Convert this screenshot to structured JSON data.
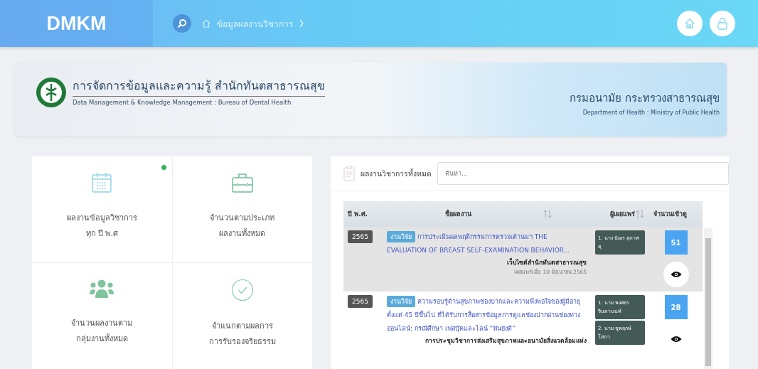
{
  "topbar": {
    "logo": "DMKM",
    "breadcrumb": "ข้อมูลผลงานวิชาการ"
  },
  "banner": {
    "title": "การจัดการข้อมูลและความรู้ สำนักทันตสาธารณสุข",
    "subtitle": "Data Management & Knowledge Management : Bureau of Dental Health",
    "department": "กรมอนามัย กระทรวงสาธารณสุข",
    "department_en": "Department of Health : Ministry of Public Health"
  },
  "menu_tiles": [
    {
      "kind": "calendar",
      "lines": [
        "ผลงานข้อมูลวิชาการ",
        "ทุก ปี พ.ศ"
      ],
      "notification": true
    },
    {
      "kind": "briefcase",
      "lines": [
        "จำนวนตามประเภท",
        "ผลงานทั้งหมด"
      ],
      "notification": false
    },
    {
      "kind": "people",
      "lines": [
        "จำนวนผลงานตาม",
        "กลุ่มงานทั้งหมด"
      ],
      "notification": false
    },
    {
      "kind": "check",
      "lines": [
        "จำแนกตามผลการ",
        "การรับรองจริยธรรม"
      ],
      "notification": false
    }
  ],
  "panel": {
    "title": "ผลงานวิชาการทั้งหมด",
    "search": {
      "placeholder": "ค้นหา..."
    },
    "table": {
      "columns": [
        {
          "label": "ปี พ.ศ.",
          "sortable": false
        },
        {
          "label": "ชื่อผลงาน",
          "sortable": true
        },
        {
          "label": "ผู้เผยแพร่",
          "sortable": true
        },
        {
          "label": "จำนวนเข้าดู",
          "sortable": false
        }
      ],
      "rows": [
        {
          "selected": true,
          "year": "2565",
          "tag": "งานวิจัย",
          "title": "การประเมินผลพฤติกรรมการตรวจเต้านมฯ THE EVALUATION OF BREAST SELF-EXAMINATION BEHAVIOR...",
          "source": "เว็บไซต์สำนักทันตสาธารณสุข",
          "date": "เผยแพร่เมื่อ 10 มิถุนายน 2565",
          "authors": [
            "1. นาง บังอร สุภาพคุ"
          ],
          "views": "51"
        },
        {
          "selected": false,
          "year": "2565",
          "tag": "งานวิจัย",
          "title": "ความรอบรู้ด้านสุขภาพช่องปากและความพึงพอใจของผู้มีอายุตั้งแต่ 45 ปีขึ้นไป ที่ได้รับการสื่อสารข้อมูลการดูแลช่องปากผ่านช่องทางออนไลน์: กรณีศึกษา เฟสบุ๊คและไลน์ “ฟันยังดี”",
          "source": "การประชุมวิชาการส่งเสริมสุขภาพและอนามัยสิ่งแวดล้อมแห่ง",
          "authors": [
            "1. นาย พงศธร จินดานนท์",
            "2. นาย ชูพฤกษ์ โสภา"
          ],
          "views": "28"
        }
      ]
    }
  }
}
